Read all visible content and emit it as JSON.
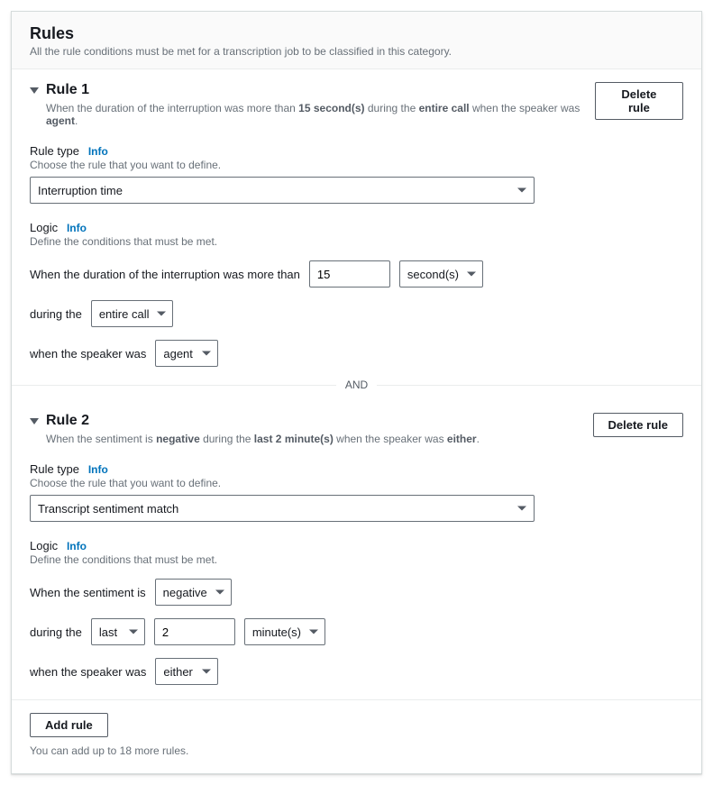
{
  "panel": {
    "title": "Rules",
    "subtitle": "All the rule conditions must be met for a transcription job to be classified in this category."
  },
  "common": {
    "delete_rule": "Delete rule",
    "rule_type_label": "Rule type",
    "rule_type_hint": "Choose the rule that you want to define.",
    "logic_label": "Logic",
    "logic_hint": "Define the conditions that must be met.",
    "info": "Info",
    "and": "AND",
    "add_rule": "Add rule"
  },
  "rule1": {
    "title": "Rule 1",
    "summary_pre": "When the duration of the interruption was more than ",
    "summary_b1": "15 second(s)",
    "summary_mid1": " during the ",
    "summary_b2": "entire call",
    "summary_mid2": " when the speaker was ",
    "summary_b3": "agent",
    "summary_end": ".",
    "rule_type_value": "Interruption time",
    "logic_text1": "When the duration of the interruption was more than",
    "duration_value": "15",
    "duration_unit": "second(s)",
    "logic_text2": "during the",
    "period_value": "entire call",
    "logic_text3": "when the speaker was",
    "speaker_value": "agent"
  },
  "rule2": {
    "title": "Rule 2",
    "summary_pre": "When the sentiment is ",
    "summary_b1": "negative",
    "summary_mid1": " during the ",
    "summary_b2": "last 2 minute(s)",
    "summary_mid2": " when the speaker was ",
    "summary_b3": "either",
    "summary_end": ".",
    "rule_type_value": "Transcript sentiment match",
    "logic_text1": "When the sentiment is",
    "sentiment_value": "negative",
    "logic_text2": "during the",
    "period_mode": "last",
    "period_amount": "2",
    "period_unit": "minute(s)",
    "logic_text3": "when the speaker was",
    "speaker_value": "either"
  },
  "footer": {
    "remaining": "You can add up to 18 more rules."
  }
}
